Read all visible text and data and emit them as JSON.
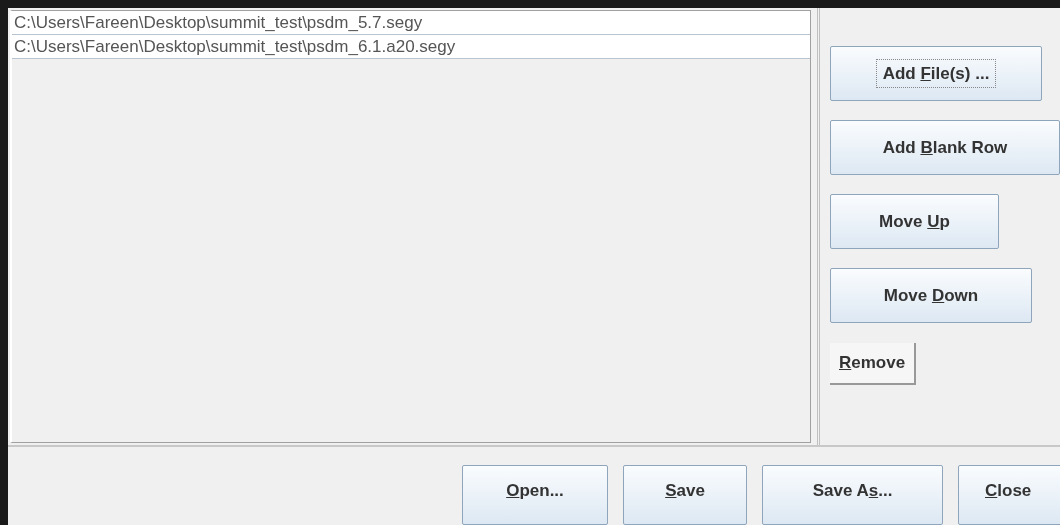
{
  "file_list": {
    "rows": [
      {
        "path": "C:\\Users\\Fareen\\Desktop\\summit_test\\psdm_5.7.segy"
      },
      {
        "path": "C:\\Users\\Fareen\\Desktop\\summit_test\\psdm_6.1.a20.segy"
      }
    ]
  },
  "side_buttons": [
    {
      "kind": "raised",
      "label": {
        "before": "Add ",
        "mnemonic": "F",
        "after": "ile(s) ..."
      },
      "focused": true
    },
    {
      "kind": "raised",
      "label": {
        "before": "Add ",
        "mnemonic": "B",
        "after": "lank Row"
      },
      "focused": false
    },
    {
      "kind": "raised",
      "label": {
        "before": "Move ",
        "mnemonic": "U",
        "after": "p"
      },
      "focused": false
    },
    {
      "kind": "raised",
      "label": {
        "before": "Move ",
        "mnemonic": "D",
        "after": "own"
      },
      "focused": false
    },
    {
      "kind": "flat",
      "label": {
        "mnemonic": "R",
        "after": "emove"
      },
      "focused": false
    }
  ],
  "bottom_buttons": [
    {
      "label": {
        "mnemonic": "O",
        "after": "pen..."
      }
    },
    {
      "label": {
        "mnemonic": "S",
        "after": "ave"
      }
    },
    {
      "label": {
        "before": "Save A",
        "mnemonic": "s",
        "after": "..."
      }
    },
    {
      "label": {
        "mnemonic": "C",
        "after": "lose"
      }
    }
  ]
}
